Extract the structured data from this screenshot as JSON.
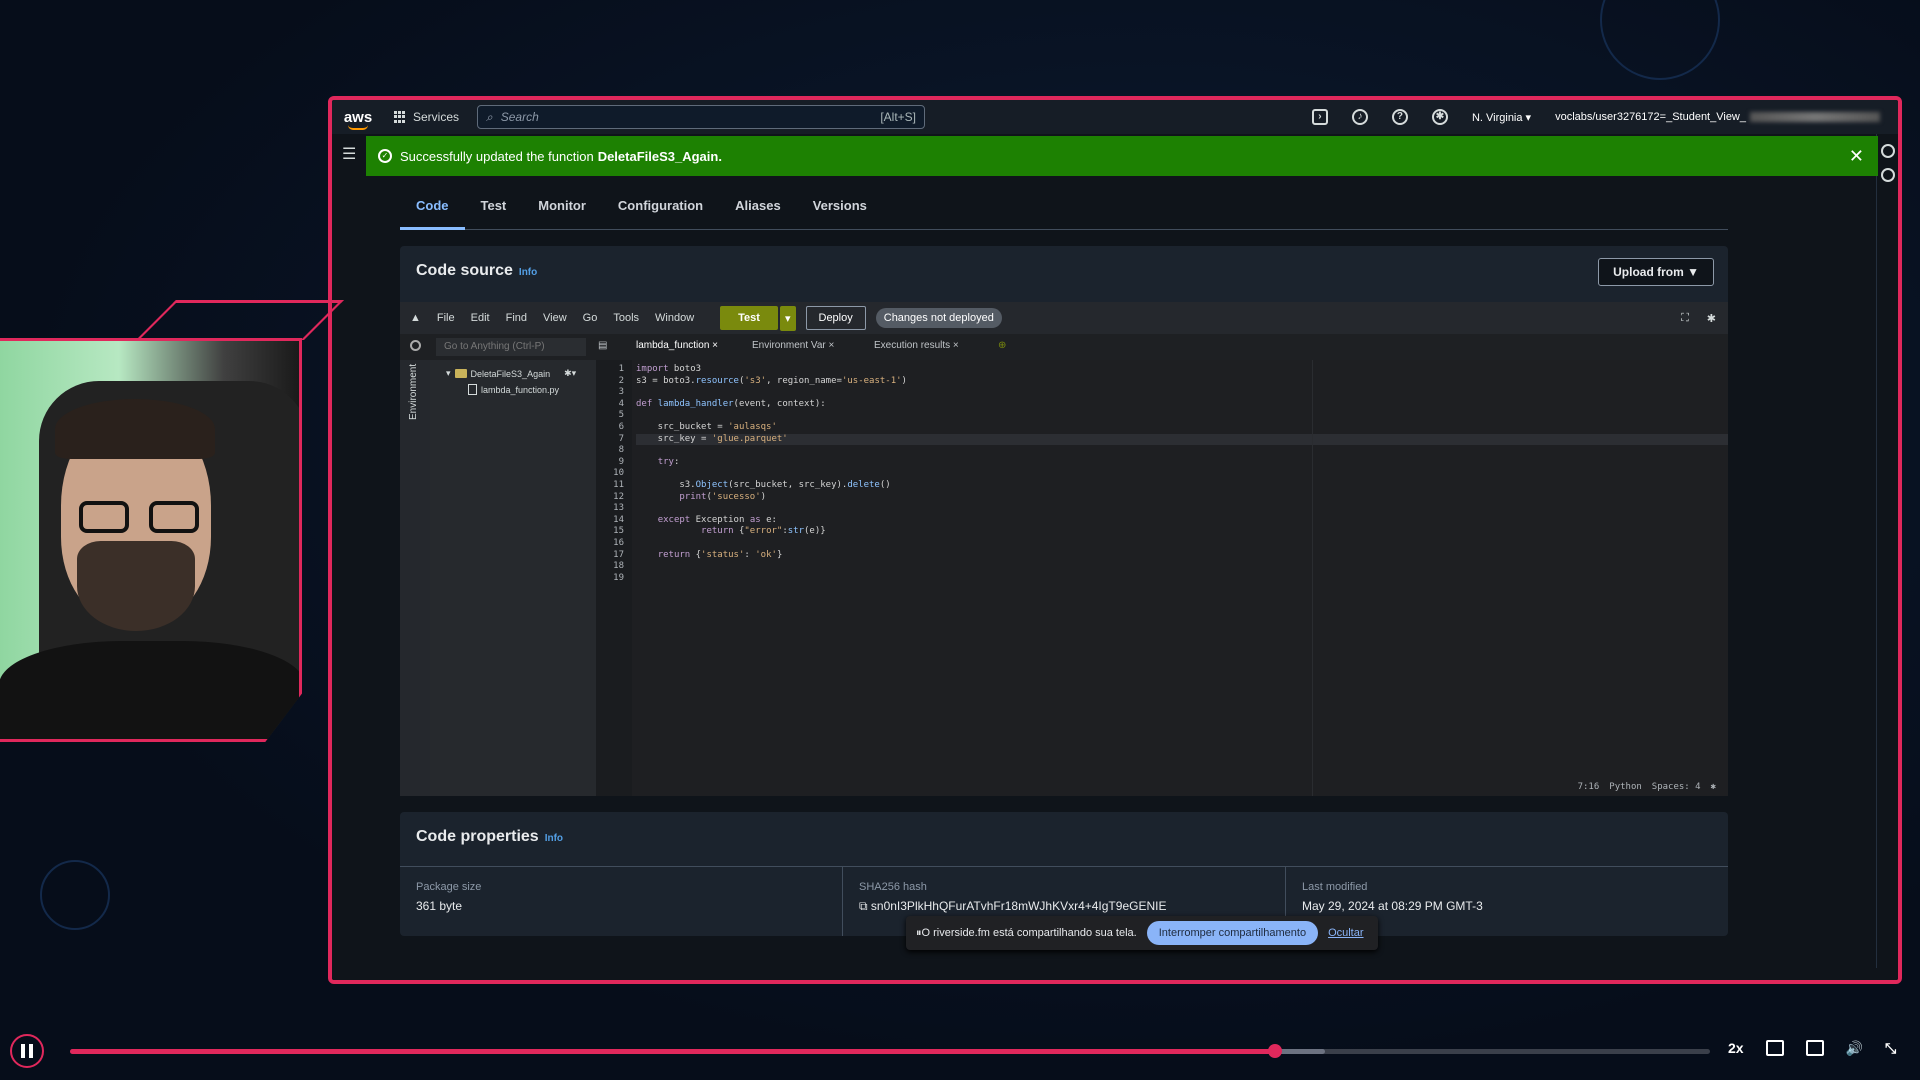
{
  "topnav": {
    "logo": "aws",
    "services": "Services",
    "search_placeholder": "Search",
    "search_shortcut": "[Alt+S]",
    "region": "N. Virginia ▾",
    "account": "voclabs/user3276172=_Student_View_"
  },
  "flash": {
    "prefix": "Successfully updated the function",
    "function_name": "DeletaFileS3_Again."
  },
  "tabs": [
    "Code",
    "Test",
    "Monitor",
    "Configuration",
    "Aliases",
    "Versions"
  ],
  "code_source": {
    "title": "Code source",
    "info": "Info",
    "upload_button": "Upload from ▼"
  },
  "ide": {
    "menu": [
      "File",
      "Edit",
      "Find",
      "View",
      "Go",
      "Tools",
      "Window"
    ],
    "test_button": "Test",
    "deploy_button": "Deploy",
    "status_badge": "Changes not deployed",
    "goto_placeholder": "Go to Anything (Ctrl-P)",
    "file_tabs": [
      "lambda_function ×",
      "Environment Var ×",
      "Execution results ×"
    ],
    "environment_label": "Environment",
    "tree_folder": "DeletaFileS3_Again",
    "tree_file": "lambda_function.py",
    "line_numbers": [
      "1",
      "2",
      "3",
      "4",
      "5",
      "6",
      "7",
      "8",
      "9",
      "10",
      "11",
      "12",
      "13",
      "14",
      "15",
      "16",
      "17",
      "18",
      "19"
    ],
    "status": {
      "position": "7:16",
      "language": "Python",
      "spaces": "Spaces: 4"
    }
  },
  "code_properties": {
    "title": "Code properties",
    "info": "Info",
    "package_size_label": "Package size",
    "package_size": "361 byte",
    "sha_label": "SHA256 hash",
    "sha_value": "sn0nI3PlkHhQFurATvhFr18mWJhKVxr4+4IgT9eGENIE",
    "last_modified_label": "Last modified",
    "last_modified": "May 29, 2024 at 08:29 PM GMT-3"
  },
  "share_bar": {
    "message": "O riverside.fm está compartilhando sua tela.",
    "stop": "Interromper compartilhamento",
    "hide": "Ocultar"
  },
  "player": {
    "progress": 0.735,
    "buffered": 0.765,
    "speed": "2x"
  },
  "colors": {
    "accent": "#e0285c",
    "success": "#1d8102",
    "aws_link": "#539fe5"
  }
}
